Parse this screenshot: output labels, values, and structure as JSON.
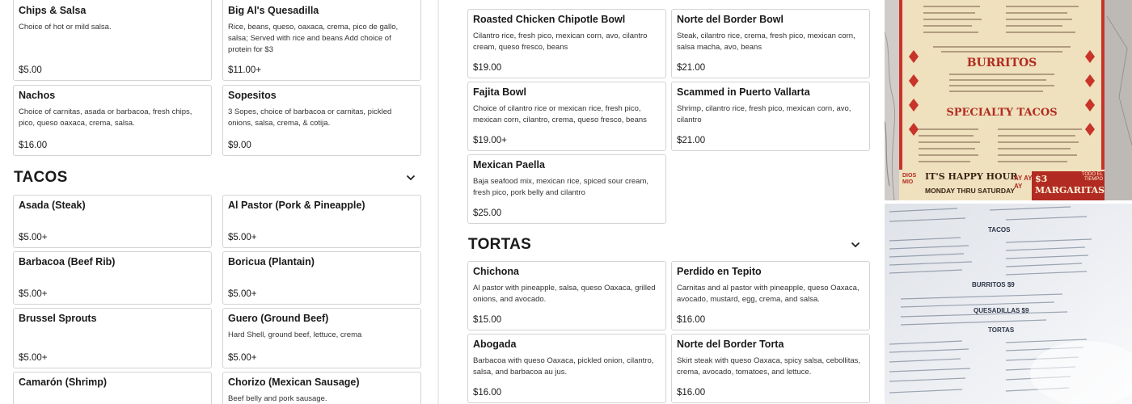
{
  "left": {
    "items_top": [
      {
        "name": "Chips & Salsa",
        "desc": "Choice of hot or mild salsa.",
        "price": "$5.00"
      },
      {
        "name": "Big Al's Quesadilla",
        "desc": "Rice, beans, queso, oaxaca, crema, pico de gallo, salsa; Served with rice and beans Add choice of protein for $3",
        "price": "$11.00+"
      },
      {
        "name": "Nachos",
        "desc": "Choice of carnitas, asada or barbacoa, fresh chips, pico, queso oaxaca, crema, salsa.",
        "price": "$16.00"
      },
      {
        "name": "Sopesitos",
        "desc": "3 Sopes, choice of barbacoa or carnitas, pickled onions, salsa, crema, & cotija.",
        "price": "$9.00"
      }
    ],
    "tacos_section": {
      "title": "TACOS",
      "toggle_icon": "chevron-down-icon"
    },
    "tacos": [
      {
        "name": "Asada (Steak)",
        "desc": "",
        "price": "$5.00+"
      },
      {
        "name": "Al Pastor (Pork & Pineapple)",
        "desc": "",
        "price": "$5.00+"
      },
      {
        "name": "Barbacoa (Beef Rib)",
        "desc": "",
        "price": "$5.00+"
      },
      {
        "name": "Boricua (Plantain)",
        "desc": "",
        "price": "$5.00+"
      },
      {
        "name": "Brussel Sprouts",
        "desc": "",
        "price": "$5.00+"
      },
      {
        "name": "Guero (Ground Beef)",
        "desc": "Hard Shell, ground beef, lettuce, crema",
        "price": "$5.00+"
      },
      {
        "name": "Camarón (Shrimp)",
        "desc": "",
        "price": ""
      },
      {
        "name": "Chorizo (Mexican Sausage)",
        "desc": "Beef belly and pork sausage.",
        "price": ""
      }
    ]
  },
  "right": {
    "bowls": [
      {
        "name": "Roasted Chicken Chipotle Bowl",
        "desc": "Cilantro rice, fresh pico, mexican corn, avo, cilantro cream, queso fresco, beans",
        "price": "$19.00"
      },
      {
        "name": "Norte del Border Bowl",
        "desc": "Steak, cilantro rice, crema, fresh pico, mexican corn, salsa macha, avo, beans",
        "price": "$21.00"
      },
      {
        "name": "Fajita Bowl",
        "desc": "Choice of cilantro rice or mexican rice, fresh pico, mexican corn, cilantro, crema, queso fresco, beans",
        "price": "$19.00+"
      },
      {
        "name": "Scammed in Puerto Vallarta",
        "desc": "Shrimp, cilantro rice, fresh pico, mexican corn, avo, cilantro",
        "price": "$21.00"
      },
      {
        "name": "Mexican Paella",
        "desc": "Baja seafood mix, mexican rice, spiced sour cream, fresh pico, pork belly and cilantro",
        "price": "$25.00"
      }
    ],
    "tortas_section": {
      "title": "TORTAS",
      "toggle_icon": "chevron-down-icon"
    },
    "tortas": [
      {
        "name": "Chichona",
        "desc": "Al pastor with pineapple, salsa, queso Oaxaca, grilled onions, and avocado.",
        "price": "$15.00"
      },
      {
        "name": "Perdido en Tepito",
        "desc": "Carnitas and al pastor with pineapple, queso Oaxaca, avocado, mustard, egg, crema, and salsa.",
        "price": "$16.00"
      },
      {
        "name": "Abogada",
        "desc": "Barbacoa with queso Oaxaca, pickled onion, cilantro, salsa, and barbacoa au jus.",
        "price": "$16.00"
      },
      {
        "name": "Norte del Border Torta",
        "desc": "Skirt steak with queso Oaxaca, spicy salsa, cebollitas, crema, avocado, tomatoes, and lettuce.",
        "price": "$16.00"
      }
    ]
  },
  "photos": {
    "top": {
      "burritos": "BURRITOS",
      "specialty_tacos": "SPECIALTY TACOS",
      "happy_hour": "IT'S HAPPY HOUR",
      "days": "MONDAY THRU SATURDAY",
      "margaritas": "$3 MARGARITAS",
      "todo": "TODO EL TIEMPO",
      "ay": "AY AY AY",
      "dios_mio": "DIOS MIO"
    },
    "bottom": {
      "tacos": "TACOS",
      "burritos": "BURRITOS $9",
      "quesadillas": "QUESADILLAS $9",
      "tortas": "TORTAS"
    }
  },
  "colors": {
    "card_border": "#d3d3d3",
    "poster_bg": "#efe1bd",
    "poster_red": "#c8332a",
    "marble": "#c9c6c3",
    "paper": "#e9ebf0"
  }
}
